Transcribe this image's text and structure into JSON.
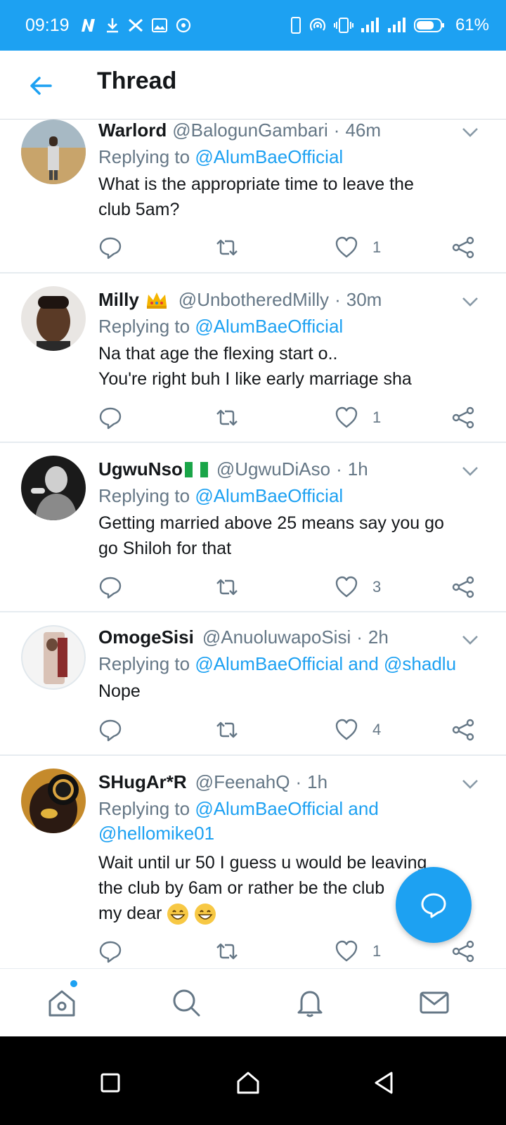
{
  "status_bar": {
    "time": "09:19",
    "battery_percent": "61%",
    "left_icons": [
      "netflix-n-icon",
      "download-icon",
      "twitter-x-icon",
      "image-icon",
      "sync-icon"
    ],
    "right_icons": [
      "phone-icon",
      "hotspot-icon",
      "vibrate-icon",
      "signal-icon",
      "signal-icon",
      "battery-icon"
    ]
  },
  "header": {
    "title": "Thread"
  },
  "colors": {
    "accent": "#1da1f2",
    "text_primary": "#14171a",
    "text_secondary": "#657786",
    "divider": "#e6ecf0"
  },
  "tweets": [
    {
      "name": "Warlord",
      "badge": "",
      "handle": "@BalogunGambari",
      "time": "46m",
      "reply_prefix": "Replying to",
      "reply_mentions": "@AlumBaeOfficial",
      "text_lines": [
        "What is the appropriate time to leave the",
        "club 5am?"
      ],
      "likes": "1"
    },
    {
      "name": "Milly",
      "badge": "crown-emoji",
      "handle": "@UnbotheredMilly",
      "time": "30m",
      "reply_prefix": "Replying to",
      "reply_mentions": "@AlumBaeOfficial",
      "text_lines": [
        "Na that age the flexing start o..",
        "You're right buh I like early marriage sha"
      ],
      "likes": "1"
    },
    {
      "name": "UgwuNso",
      "badge": "nigeria-flag-emoji",
      "handle": "@UgwuDiAso",
      "time": "1h",
      "reply_prefix": "Replying to",
      "reply_mentions": "@AlumBaeOfficial",
      "text_lines": [
        "Getting married above 25 means say you go",
        "go Shiloh for that"
      ],
      "likes": "3"
    },
    {
      "name": "OmogeSisi",
      "badge": "",
      "handle": "@AnuoluwapoSisi",
      "time": "2h",
      "reply_prefix": "Replying to",
      "reply_mentions": "@AlumBaeOfficial and @shadlu",
      "text_lines": [
        "Nope"
      ],
      "likes": "4"
    },
    {
      "name": "SHugAr*R",
      "badge": "",
      "handle": "@FeenahQ",
      "time": "1h",
      "reply_prefix": "Replying to",
      "reply_mentions": "@AlumBaeOfficial and",
      "reply_mentions_line2": "@hellomike01",
      "text_lines": [
        "Wait until ur 50 I guess u would be leaving",
        "the club by 6am or rather be the club",
        "my dear"
      ],
      "likes": "1"
    }
  ],
  "bottom_nav": {
    "items": [
      "home-icon",
      "search-icon",
      "notifications-icon",
      "messages-icon"
    ]
  },
  "system_nav": {
    "items": [
      "recents-button",
      "home-button",
      "back-button"
    ]
  }
}
